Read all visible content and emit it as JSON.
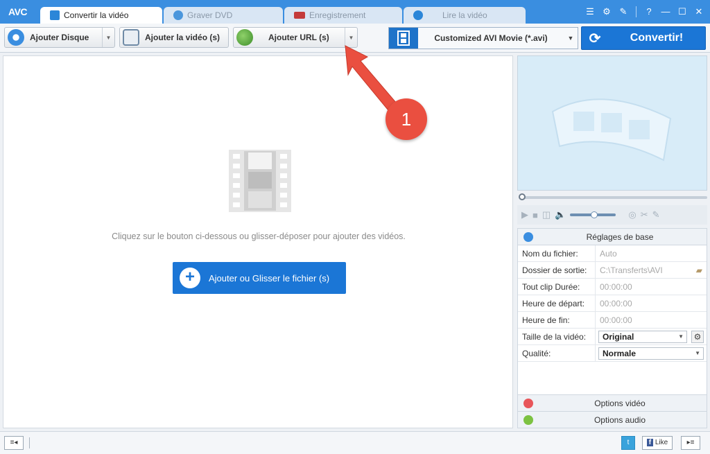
{
  "app": {
    "logo": "AVC"
  },
  "tabs": [
    {
      "label": "Convertir la vidéo",
      "active": true
    },
    {
      "label": "Graver DVD",
      "active": false
    },
    {
      "label": "Enregistrement",
      "active": false
    },
    {
      "label": "Lire la vidéo",
      "active": false
    }
  ],
  "window_controls": {
    "help": "?",
    "minimize": "—",
    "maximize": "☐",
    "close": "✕"
  },
  "toolbar": {
    "add_disc": "Ajouter Disque",
    "add_video": "Ajouter la vidéo (s)",
    "add_url": "Ajouter URL (s)",
    "format": "Customized AVI Movie (*.avi)",
    "convert": "Convertir!"
  },
  "main": {
    "hint": "Cliquez sur le bouton ci-dessous ou glisser-déposer pour ajouter des vidéos.",
    "add_button": "Ajouter ou Glisser le fichier (s)"
  },
  "annotation": {
    "number": "1"
  },
  "settings": {
    "header": "Réglages de base",
    "rows": [
      {
        "label": "Nom du fichier:",
        "value": "Auto"
      },
      {
        "label": "Dossier de sortie:",
        "value": "C:\\Transferts\\AVI"
      },
      {
        "label": "Tout clip Durée:",
        "value": "00:00:00"
      },
      {
        "label": "Heure de départ:",
        "value": "00:00:00"
      },
      {
        "label": "Heure de fin:",
        "value": "00:00:00"
      }
    ],
    "video_size_label": "Taille de la vidéo:",
    "video_size_value": "Original",
    "quality_label": "Qualité:",
    "quality_value": "Normale",
    "video_options": "Options vidéo",
    "audio_options": "Options audio"
  },
  "statusbar": {
    "like": "Like"
  },
  "colors": {
    "accent": "#1b76d6",
    "titlebar": "#3a8ee0",
    "annotation": "#ea4f40"
  }
}
